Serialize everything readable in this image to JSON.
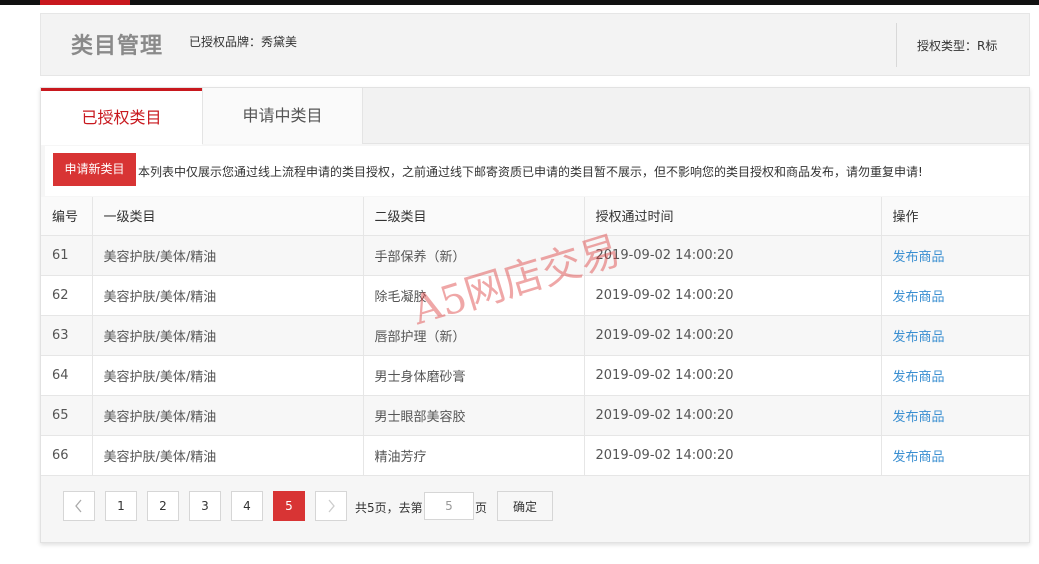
{
  "header": {
    "title": "类目管理",
    "brand": "已授权品牌：秀黛美",
    "auth_type": "授权类型：R标"
  },
  "tabs": [
    {
      "label": "已授权类目",
      "active": true
    },
    {
      "label": "申请中类目",
      "active": false
    }
  ],
  "notice": {
    "apply_button": "申请新类目",
    "text": "本列表中仅展示您通过线上流程申请的类目授权，之前通过线下邮寄资质已申请的类目暂不展示，但不影响您的类目授权和商品发布，请勿重复申请!"
  },
  "table": {
    "columns": [
      "编号",
      "一级类目",
      "二级类目",
      "授权通过时间",
      "操作"
    ],
    "rows": [
      {
        "id": "61",
        "cat1": "美容护肤/美体/精油",
        "cat2": "手部保养（新）",
        "time": "2019-09-02 14:00:20",
        "action": "发布商品"
      },
      {
        "id": "62",
        "cat1": "美容护肤/美体/精油",
        "cat2": "除毛凝胶",
        "time": "2019-09-02 14:00:20",
        "action": "发布商品"
      },
      {
        "id": "63",
        "cat1": "美容护肤/美体/精油",
        "cat2": "唇部护理（新）",
        "time": "2019-09-02 14:00:20",
        "action": "发布商品"
      },
      {
        "id": "64",
        "cat1": "美容护肤/美体/精油",
        "cat2": "男士身体磨砂膏",
        "time": "2019-09-02 14:00:20",
        "action": "发布商品"
      },
      {
        "id": "65",
        "cat1": "美容护肤/美体/精油",
        "cat2": "男士眼部美容胶",
        "time": "2019-09-02 14:00:20",
        "action": "发布商品"
      },
      {
        "id": "66",
        "cat1": "美容护肤/美体/精油",
        "cat2": "精油芳疗",
        "time": "2019-09-02 14:00:20",
        "action": "发布商品"
      }
    ]
  },
  "pager": {
    "prev_icon": "chevron-left-icon",
    "next_icon": "chevron-right-icon",
    "pages": [
      "1",
      "2",
      "3",
      "4",
      "5"
    ],
    "current": "5",
    "total_text": "共5页，去第",
    "input_value": "5",
    "page_suffix": "页",
    "confirm_label": "确定"
  },
  "watermark": "A5网店交易",
  "colors": {
    "accent": "#c8181e",
    "button": "#d83434",
    "link": "#3a8fd1"
  }
}
